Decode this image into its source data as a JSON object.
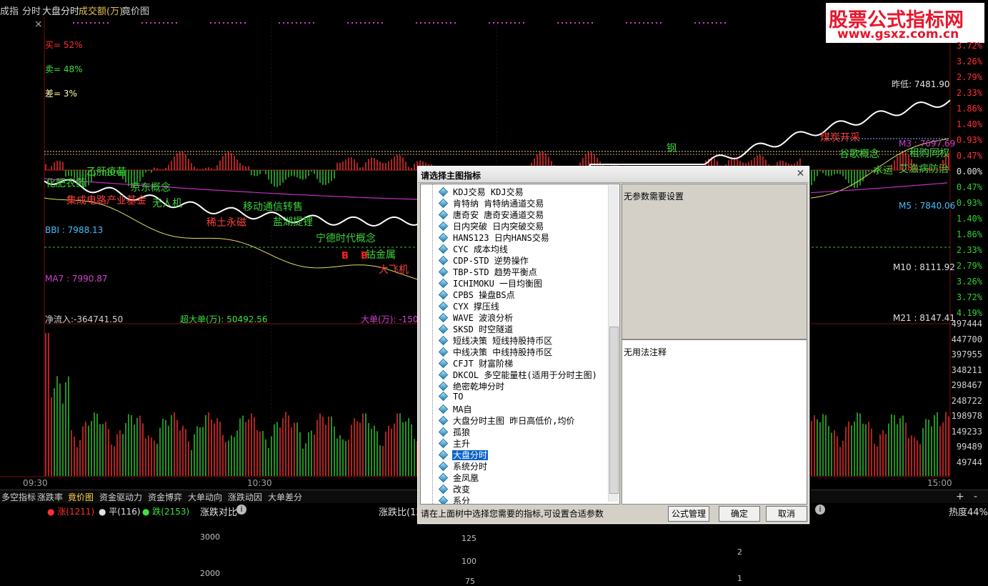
{
  "topbar": {
    "items": [
      "成指",
      "分时",
      "大盘分时",
      "成交额(万)",
      "竟价图"
    ]
  },
  "watermark": {
    "title": "股票公式指标网",
    "url": "www.gsxz.com.cn"
  },
  "left_labels": {
    "buy": "买= 52%",
    "sell": "卖= 48%",
    "diff": "差= 3%",
    "bbi": "BBI : 7988.13",
    "ma7": "MA7 : 7990.87",
    "net_inflow": "净流入:-364741.50",
    "big_order": "超大单(万): 50492.56",
    "big_order2": "大单(万): -1501"
  },
  "right_labels": {
    "prev_low": "昨低: 7481.90",
    "m3": "M3 : 7697.69",
    "m5": "M5 : 7840.06",
    "m10": "M10 : 8111.92",
    "m21": "M21 : 8147.41"
  },
  "pct_axis": [
    "3.72%",
    "3.26%",
    "2.79%",
    "2.33%",
    "1.86%",
    "1.40%",
    "0.93%",
    "0.47%",
    "0.00%",
    "0.47%",
    "0.93%",
    "1.40%",
    "1.86%",
    "2.33%",
    "2.79%",
    "3.26%",
    "3.72%",
    "4.19%"
  ],
  "vol_axis": [
    "497444",
    "447700",
    "397955",
    "348211",
    "298467",
    "248722",
    "198978",
    "149233",
    "99489",
    "49744"
  ],
  "time_axis": [
    "09:30",
    "10:30",
    "15:00"
  ],
  "annotations": [
    {
      "text": "化肥农药",
      "color": "#3cd23c"
    },
    {
      "text": "乙肝疫苗",
      "color": "#3cd23c"
    },
    {
      "text": "京东概念",
      "color": "#3cd23c"
    },
    {
      "text": "集成电路产业基金",
      "color": "#ff4040"
    },
    {
      "text": "无人机",
      "color": "#3cd23c"
    },
    {
      "text": "稀土永磁",
      "color": "#ff4040"
    },
    {
      "text": "移动通信转售",
      "color": "#3cd23c"
    },
    {
      "text": "盐湖提锂",
      "color": "#3cd23c"
    },
    {
      "text": "宁德时代概念",
      "color": "#3cd23c"
    },
    {
      "text": "钴金属",
      "color": "#3cd23c"
    },
    {
      "text": "大飞机",
      "color": "#ff4040"
    },
    {
      "text": "钢",
      "color": "#3cd23c"
    },
    {
      "text": "煤炭开采",
      "color": "#ff4040"
    },
    {
      "text": "谷歌概念",
      "color": "#3cd23c"
    },
    {
      "text": "水运",
      "color": "#3cd23c"
    },
    {
      "text": "艾滋病防治",
      "color": "#3cd23c"
    },
    {
      "text": "租购同权",
      "color": "#3cd23c"
    },
    {
      "text": "B",
      "color": "#ff2020"
    },
    {
      "text": "B",
      "color": "#ff2020"
    }
  ],
  "tabs": [
    "多空指标",
    "涨跌率",
    "竟价图",
    "资金驱动力",
    "资金博弈",
    "大单动向",
    "涨跌动因",
    "大单差分"
  ],
  "tab_controls": [
    "+",
    "-"
  ],
  "bottom": {
    "rise": "涨(1211)",
    "flat": "平(116)",
    "fall": "跌(2153)",
    "panel2_title": "涨跌对比",
    "panel3_title": "涨跌比(12",
    "panel5_title": "热度44%",
    "p2_ticks": [
      "3000",
      "2000"
    ],
    "p3_ticks": [
      "125",
      "100",
      "75"
    ],
    "p4_ticks": [
      "2",
      "1"
    ]
  },
  "dialog": {
    "title": "请选择主图指标",
    "items": [
      "KDJ交易 KDJ交易",
      "肯特纳 肯特纳通道交易",
      "唐奇安 唐奇安通道交易",
      "日内突破 日内突破交易",
      "HANS123 日内HANS交易",
      "CYC 成本均线",
      "CDP-STD 逆势操作",
      "TBP-STD 趋势平衡点",
      "ICHIMOKU 一目均衡图",
      "CPBS 操盘BS点",
      "CYX 撑压线",
      "WAVE 波浪分析",
      "SKSD 时空隧道",
      "短线决策 短线持股持币区",
      "中线决策 中线持股持币区",
      "CFJT 财富阶梯",
      "DKCOL 多空能量柱(适用于分时主图)",
      "绝密乾坤分时",
      "TO",
      "MA自",
      "大盘分时主图 昨日高低价,均价",
      "孤狼",
      "主升",
      "大盘分时",
      "系统分时",
      "金凤凰",
      "改变",
      "系分"
    ],
    "selected_index": 23,
    "param_text": "无参数需要设置",
    "note_text": "无用法注释",
    "hint": "请在上面树中选择您需要的指标,可设置合适参数",
    "btn_formula": "公式管理",
    "btn_ok": "确定",
    "btn_cancel": "取消"
  },
  "colors": {
    "rise": "#ff3030",
    "fall": "#30d030",
    "price_line": "#ffffff",
    "avg_line": "#e0e060",
    "ma_line": "#c030c0",
    "bbi": "#40c0ff"
  }
}
